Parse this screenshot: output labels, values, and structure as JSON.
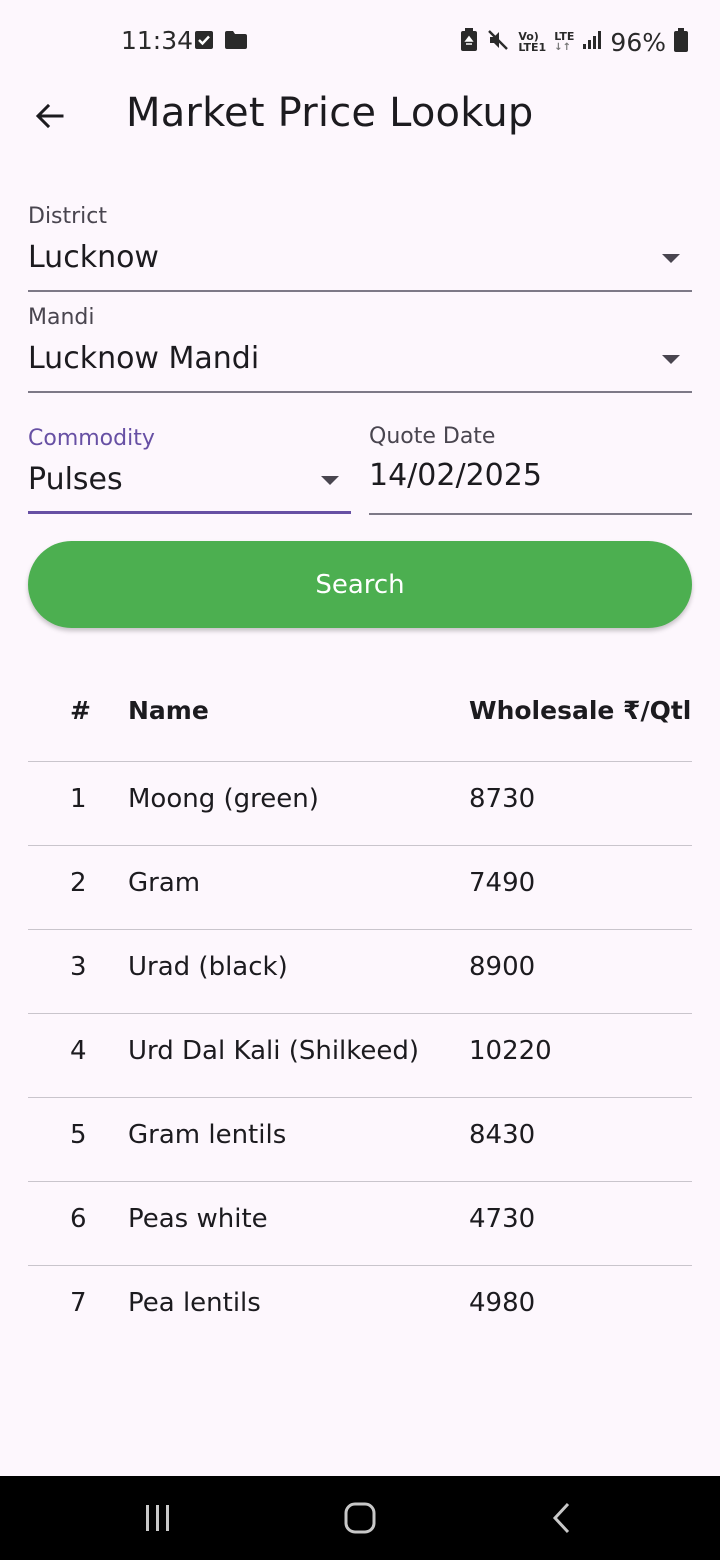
{
  "status_bar": {
    "time": "11:34",
    "battery": "96%",
    "network_top": "Vo)",
    "network_bottom": "LTE1",
    "lte": "LTE"
  },
  "app_bar": {
    "title": "Market Price Lookup",
    "back_icon": "arrow-back-icon"
  },
  "form": {
    "district": {
      "label": "District",
      "value": "Lucknow"
    },
    "mandi": {
      "label": "Mandi",
      "value": "Lucknow Mandi"
    },
    "commodity": {
      "label": "Commodity",
      "value": "Pulses"
    },
    "quote_date": {
      "label": "Quote Date",
      "value": "14/02/2025"
    },
    "search_label": "Search"
  },
  "table": {
    "headers": {
      "index": "#",
      "name": "Name",
      "wholesale": "Wholesale ₹/Qtl"
    },
    "rows": [
      {
        "index": "1",
        "name": "Moong (green)",
        "wholesale": "8730"
      },
      {
        "index": "2",
        "name": "Gram",
        "wholesale": "7490"
      },
      {
        "index": "3",
        "name": "Urad (black)",
        "wholesale": "8900"
      },
      {
        "index": "4",
        "name": "Urd Dal Kali (Shilkeed)",
        "wholesale": "10220"
      },
      {
        "index": "5",
        "name": "Gram lentils",
        "wholesale": "8430"
      },
      {
        "index": "6",
        "name": "Peas white",
        "wholesale": "4730"
      },
      {
        "index": "7",
        "name": "Pea lentils",
        "wholesale": "4980"
      }
    ]
  },
  "colors": {
    "background": "#fdf7fd",
    "accent": "#6750a4",
    "search_button": "#4caf50"
  }
}
